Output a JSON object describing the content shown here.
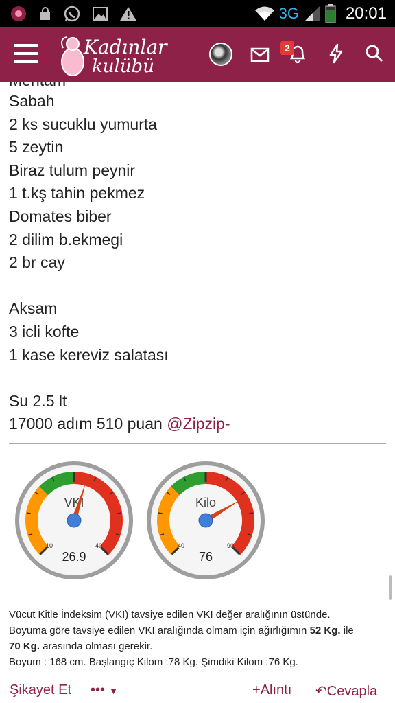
{
  "status_bar": {
    "network": "3G",
    "time": "20:01",
    "icons": [
      "app-notification-icon",
      "lock-icon",
      "whatsapp-icon",
      "image-icon",
      "warning-icon",
      "wifi-icon",
      "signal-icon",
      "battery-icon"
    ]
  },
  "app_bar": {
    "logo_line1": "Kadınlar",
    "logo_line2": "kulübü",
    "notification_count": "2",
    "accent_color": "#8e2147"
  },
  "post": {
    "partial_top": "Mehtam",
    "lines": [
      "Sabah",
      "2 ks sucuklu yumurta",
      "5 zeytin",
      "Biraz tulum peynir",
      "1 t.kş tahin pekmez",
      "Domates biber",
      "2 dilim b.ekmegi",
      "2 br cay",
      "",
      "Aksam",
      "3 icli kofte",
      "1 kase kereviz salatası",
      "",
      "Su 2.5 lt"
    ],
    "last_line_prefix": "17000 adım 510 puan",
    "mention": "@Zipzip-"
  },
  "gauges": [
    {
      "label": "VKI",
      "min_label": "10",
      "max_label": "40",
      "value_text": "26.9",
      "min": 10,
      "max": 40,
      "value": 26.9
    },
    {
      "label": "Kilo",
      "min_label": "40",
      "max_label": "90",
      "value_text": "76",
      "min": 40,
      "max": 90,
      "value": 76
    }
  ],
  "signature": {
    "line1": "Vücut Kitle İndeksim (VKI) tavsiye edilen VKI değer aralığının üstünde.",
    "line2_a": "Boyuma göre tavsiye edilen VKI aralığında olmam için ağırlığımın",
    "line2_b": "52 Kg.",
    "line2_c": "ile",
    "line3_a": "70 Kg.",
    "line3_b": "arasında olması gerekir.",
    "line4": "Boyum : 168 cm. Başlangıç Kilom :78 Kg. Şimdiki Kilom :76 Kg."
  },
  "actions": {
    "report": "Şikayet Et",
    "more": "•••",
    "quote": "Alıntı",
    "reply": "Cevapla"
  }
}
